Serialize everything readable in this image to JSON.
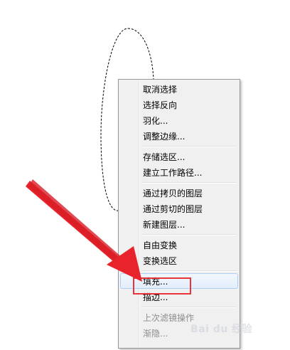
{
  "context_menu": {
    "items": [
      {
        "label": "取消选择",
        "type": "item",
        "enabled": true
      },
      {
        "label": "选择反向",
        "type": "item",
        "enabled": true
      },
      {
        "label": "羽化...",
        "type": "item",
        "enabled": true
      },
      {
        "label": "调整边缘...",
        "type": "item",
        "enabled": true
      },
      {
        "type": "separator"
      },
      {
        "label": "存储选区...",
        "type": "item",
        "enabled": true
      },
      {
        "label": "建立工作路径...",
        "type": "item",
        "enabled": true
      },
      {
        "type": "separator"
      },
      {
        "label": "通过拷贝的图层",
        "type": "item",
        "enabled": true
      },
      {
        "label": "通过剪切的图层",
        "type": "item",
        "enabled": true
      },
      {
        "label": "新建图层...",
        "type": "item",
        "enabled": true
      },
      {
        "type": "separator"
      },
      {
        "label": "自由变换",
        "type": "item",
        "enabled": true
      },
      {
        "label": "变换选区",
        "type": "item",
        "enabled": true
      },
      {
        "type": "separator"
      },
      {
        "label": "填充...",
        "type": "item",
        "enabled": true,
        "hover": true
      },
      {
        "label": "描边...",
        "type": "item",
        "enabled": true
      },
      {
        "type": "separator"
      },
      {
        "label": "上次滤镜操作",
        "type": "item",
        "enabled": false
      },
      {
        "label": "渐隐...",
        "type": "item",
        "enabled": false
      }
    ]
  },
  "annotation": {
    "highlight_color": "#e8343b",
    "arrow_color": "#e8232b",
    "target_item": "填充..."
  },
  "watermark": {
    "text": "Bai du 经验"
  },
  "colors": {
    "menu_bg": "#f0f0f0",
    "menu_border": "#979797",
    "hover_border": "#aecff7",
    "disabled_text": "#8d8d8d"
  }
}
